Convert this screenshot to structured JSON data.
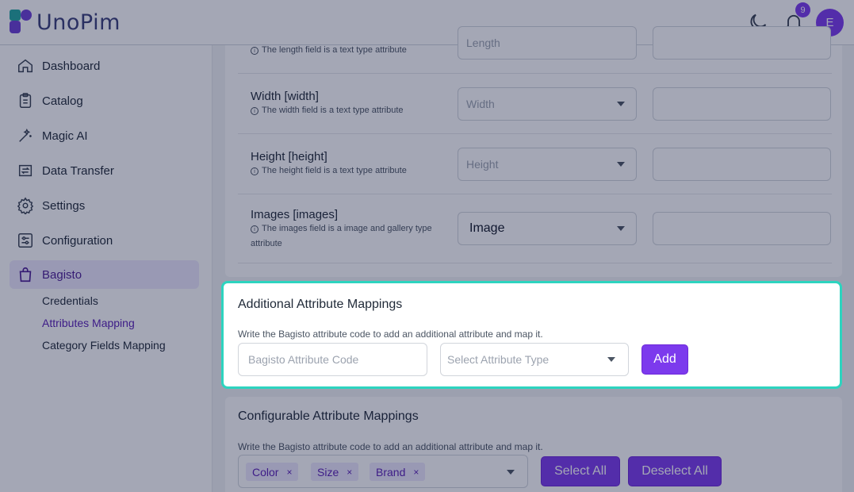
{
  "header": {
    "logo_text": "UnoPim",
    "notification_count": "9",
    "avatar_initial": "E"
  },
  "sidebar": {
    "items": [
      {
        "label": "Dashboard",
        "icon": "home-icon"
      },
      {
        "label": "Catalog",
        "icon": "clipboard-icon"
      },
      {
        "label": "Magic AI",
        "icon": "magic-wand-icon"
      },
      {
        "label": "Data Transfer",
        "icon": "data-transfer-icon"
      },
      {
        "label": "Settings",
        "icon": "gear-icon"
      },
      {
        "label": "Configuration",
        "icon": "sliders-icon"
      },
      {
        "label": "Bagisto",
        "icon": "bag-icon"
      }
    ],
    "sub_items": [
      {
        "label": "Credentials"
      },
      {
        "label": "Attributes Mapping"
      },
      {
        "label": "Category Fields Mapping"
      }
    ]
  },
  "mapping_rows": [
    {
      "title": "",
      "hint": "The length field is a text type attribute",
      "select": "Length"
    },
    {
      "title": "Width [width]",
      "hint": "The width field is a text type attribute",
      "select": "Width"
    },
    {
      "title": "Height [height]",
      "hint": "The height field is a text type attribute",
      "select": "Height"
    },
    {
      "title": "Images [images]",
      "hint": "The images field is a image and gallery type attribute",
      "select": "Image"
    }
  ],
  "additional": {
    "title": "Additional Attribute Mappings",
    "description": "Write the Bagisto attribute code to add an additional attribute and map it.",
    "code_placeholder": "Bagisto Attribute Code",
    "type_placeholder": "Select Attribute Type",
    "add_label": "Add"
  },
  "configurable": {
    "title": "Configurable Attribute Mappings",
    "description": "Write the Bagisto attribute code to add an additional attribute and map it.",
    "tags": [
      "Color",
      "Size",
      "Brand"
    ],
    "tag_remove": "×",
    "select_all_label": "Select All",
    "deselect_all_label": "Deselect All"
  },
  "colors": {
    "accent": "#7c3aed",
    "highlight_border": "#2dd4bf"
  }
}
